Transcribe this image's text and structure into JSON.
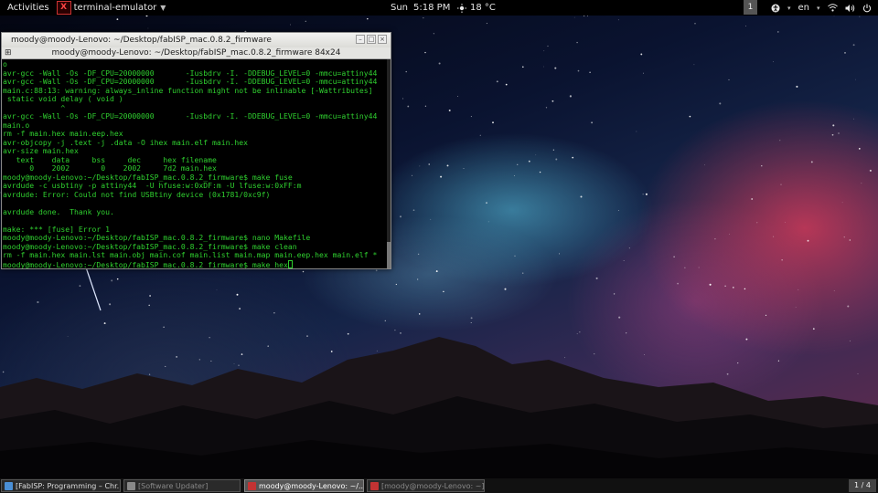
{
  "topbar": {
    "activities": "Activities",
    "app_icon_glyph": "X",
    "app_label": "terminal-emulator",
    "day": "Sun",
    "time": "5:18 PM",
    "temperature": "18 °C",
    "workspace_badge": "1",
    "lang": "en",
    "icons": [
      "accessibility-icon",
      "wifi-icon",
      "volume-icon",
      "power-icon"
    ]
  },
  "terminal": {
    "window_title": "moody@moody-Lenovo: ~/Desktop/fabISP_mac.0.8.2_firmware",
    "tab_title": "moody@moody-Lenovo: ~/Desktop/fabISP_mac.0.8.2_firmware 84x24",
    "text_color": "#2fd02f",
    "lines": [
      "o",
      "avr-gcc -Wall -Os -DF_CPU=20000000       -Iusbdrv -I. -DDEBUG_LEVEL=0 -mmcu=attiny44",
      "avr-gcc -Wall -Os -DF_CPU=20000000       -Iusbdrv -I. -DDEBUG_LEVEL=0 -mmcu=attiny44",
      "main.c:88:13: warning: always_inline function might not be inlinable [-Wattributes]",
      " static void delay ( void )",
      "             ^",
      "avr-gcc -Wall -Os -DF_CPU=20000000       -Iusbdrv -I. -DDEBUG_LEVEL=0 -mmcu=attiny44",
      "main.o",
      "rm -f main.hex main.eep.hex",
      "avr-objcopy -j .text -j .data -O ihex main.elf main.hex",
      "avr-size main.hex",
      "   text    data     bss     dec     hex filename",
      "      0    2002       0    2002     7d2 main.hex",
      "moody@moody-Lenovo:~/Desktop/fabISP_mac.0.8.2_firmware$ make fuse",
      "avrdude -c usbtiny -p attiny44  -U hfuse:w:0xDF:m -U lfuse:w:0xFF:m",
      "avrdude: Error: Could not find USBtiny device (0x1781/0xc9f)",
      "",
      "avrdude done.  Thank you.",
      "",
      "make: *** [fuse] Error 1",
      "moody@moody-Lenovo:~/Desktop/fabISP_mac.0.8.2_firmware$ nano Makefile",
      "moody@moody-Lenovo:~/Desktop/fabISP_mac.0.8.2_firmware$ make clean",
      "rm -f main.hex main.lst main.obj main.cof main.list main.map main.eep.hex main.elf *",
      "moody@moody-Lenovo:~/Desktop/fabISP_mac.0.8.2_firmware$ make hex"
    ]
  },
  "taskbar": {
    "tasks": [
      {
        "label": "[FabISP: Programming – Chr...",
        "icon_color": "#4a8fd6",
        "state": "normal"
      },
      {
        "label": "[Software Updater]",
        "icon_color": "#888888",
        "state": "dim"
      },
      {
        "label": "moody@moody-Lenovo: ~/...",
        "icon_color": "#c33333",
        "state": "active"
      },
      {
        "label": "[moody@moody-Lenovo: ~]",
        "icon_color": "#c33333",
        "state": "dim"
      }
    ],
    "pager": "1 / 4"
  }
}
